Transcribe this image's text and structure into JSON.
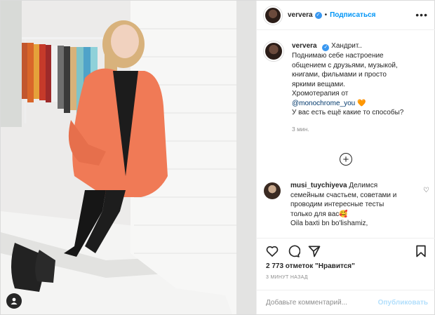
{
  "header": {
    "username": "ververa",
    "separator": "•",
    "follow_label": "Подписаться",
    "more_label": "•••"
  },
  "caption": {
    "username": "ververa",
    "line1": "Хандрит..",
    "line2": "Поднимаю себе настроение",
    "line3": "общением с друзьями, музыкой,",
    "line4": "книгами, фильмами и просто",
    "line5": "яркими вещами.",
    "line6": "Хромотерапия от",
    "mention": "@monochrome_you",
    "heart": "🧡",
    "line8": "У вас есть ещё какие то способы?",
    "time_ago": "3 мин."
  },
  "load_more_label": "+",
  "comment": {
    "username": "musi_tuychiyeva",
    "line1": "Делимся",
    "line2": "семейным счастьем, советами и",
    "line3": "проводим интересные тесты",
    "line4": "только для вас",
    "emoji": "🥰",
    "line5": "Oila baxti bn bo'lishamiz,",
    "like_icon": "♡"
  },
  "likes": "2 773 отметок \"Нравится\"",
  "post_time": "3 МИНУТ НАЗАД",
  "add_comment": {
    "placeholder": "Добавьте комментарий...",
    "publish_label": "Опубликовать"
  },
  "colors": {
    "link": "#0095f6",
    "publish_disabled": "#b2dffc",
    "cardigan": "#f07a56",
    "secondary_text": "#8e8e8e"
  }
}
